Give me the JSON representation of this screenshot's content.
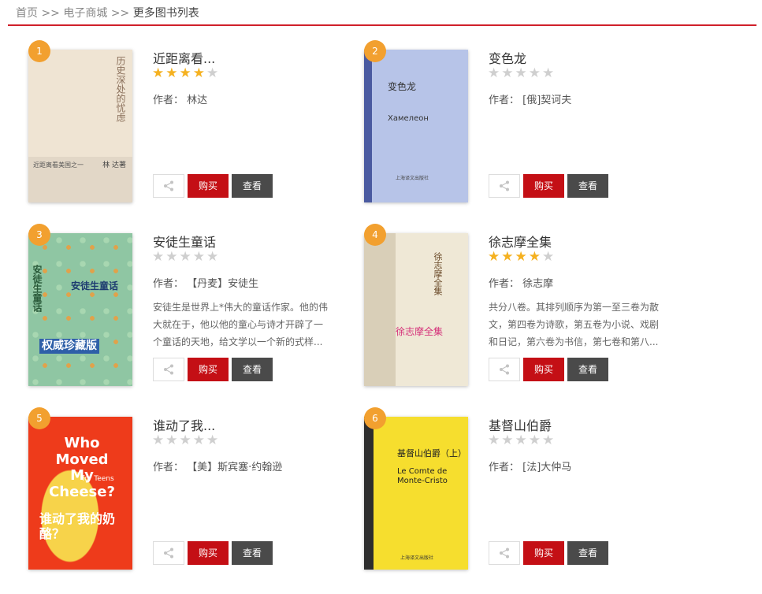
{
  "breadcrumb": {
    "home": "首页",
    "sep1": ">>",
    "mall": "电子商城",
    "sep2": ">>",
    "current": "更多图书列表"
  },
  "buttons": {
    "buy": "购买",
    "view": "查看"
  },
  "books": [
    {
      "rank": "1",
      "title": "近距离看...",
      "rating": 4,
      "author": "作者：  林达",
      "desc": "",
      "cover": {
        "bg": "#e7dccd",
        "text1": "历史深处的忧虑",
        "text2": "近距离看美国之一",
        "text3": "林 达著"
      }
    },
    {
      "rank": "2",
      "title": "变色龙",
      "rating": 0,
      "author": "作者：  [俄]契诃夫",
      "desc": "",
      "cover": {
        "bg": "#b7c4e8",
        "text1": "变色龙",
        "text2": "Хамелеон",
        "text3": "上海译文出版社"
      }
    },
    {
      "rank": "3",
      "title": "安徒生童话",
      "rating": 0,
      "author": "作者：  【丹麦】安徒生",
      "desc": "安徒生是世界上*伟大的童话作家。他的伟大就在于，他以他的童心与诗才开辟了一个童话的天地，给文学以一个新的式样...",
      "cover": {
        "bg": "#8fc6a3",
        "text1": "安徒生童话",
        "text2": "安徒生童话",
        "text3": "权威珍藏版"
      }
    },
    {
      "rank": "4",
      "title": "徐志摩全集",
      "rating": 4,
      "author": "作者：  徐志摩",
      "desc": "共分八卷。其排列顺序为第一至三卷为散文，第四卷为诗歌，第五卷为小说、戏剧和日记，第六卷为书信，第七卷和第八...",
      "cover": {
        "bg": "#efe8d6",
        "text1": "徐志摩全集",
        "text2": "徐志摩全集",
        "text3": ""
      }
    },
    {
      "rank": "5",
      "title": "谁动了我...",
      "rating": 0,
      "author": "作者：  【美】斯宾塞·约翰逊",
      "desc": "",
      "cover": {
        "bg": "#ee3b1b",
        "text1": "Who Moved My Cheese?",
        "text2": "for Teens",
        "text3": "谁动了我的奶酪？"
      }
    },
    {
      "rank": "6",
      "title": "基督山伯爵",
      "rating": 0,
      "author": "作者：  [法]大仲马",
      "desc": "",
      "cover": {
        "bg": "#f6de2e",
        "text1": "基督山伯爵（上）",
        "text2": "Le Comte de Monte-Cristo",
        "text3": "上海译文出版社"
      }
    }
  ],
  "colors": {
    "accent": "#c40f15",
    "badge": "#f2a02f",
    "star": "#f5b120"
  }
}
